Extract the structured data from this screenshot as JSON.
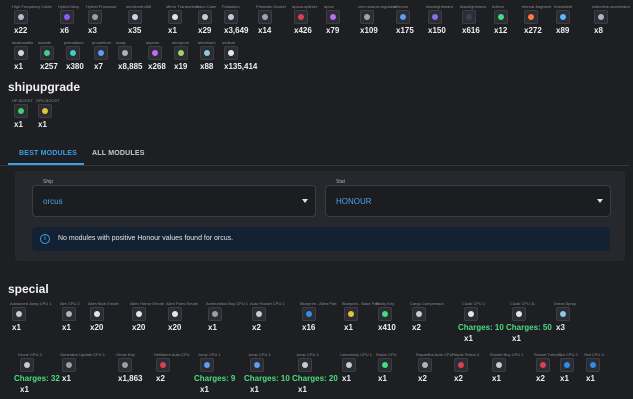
{
  "misc_row1": [
    {
      "label": "High Frequency Cable",
      "count": "x22",
      "color": "#b8bcc4"
    },
    {
      "label": "Hybrid Alloy",
      "count": "x6",
      "color": "#8b5cf6"
    },
    {
      "label": "Hybrid Processor",
      "count": "x3",
      "color": "#9aa0aa"
    },
    {
      "label": "mindcontrol56",
      "count": "x35",
      "color": "#cfd3da"
    },
    {
      "label": "Mirror Transceiver",
      "count": "x1",
      "color": "#dfe2e8"
    },
    {
      "label": "Nano Case",
      "count": "x29",
      "color": "#c9ccd2"
    },
    {
      "label": "Palladium",
      "count": "x3,649",
      "color": "#c4c8cf"
    },
    {
      "label": "Prismatic Socket",
      "count": "x14",
      "color": "#a0a4ab"
    },
    {
      "label": "apoca-splinter",
      "count": "x426",
      "color": "#d9434f"
    },
    {
      "label": "aprox",
      "count": "x79",
      "color": "#b66df2"
    },
    {
      "label": "cmrr-swarm-regulator",
      "count": "x109",
      "color": "#9ea3ac"
    },
    {
      "label": "bifercon",
      "count": "x175",
      "color": "#5b9ff0"
    },
    {
      "label": "blacklightneant",
      "count": "x150",
      "color": "#8c6be8"
    },
    {
      "label": "blacklightmecs",
      "count": "x616",
      "color": "#3a3f55"
    },
    {
      "label": "boltron",
      "count": "x12",
      "color": "#3fe07a"
    },
    {
      "label": "eternal-fragment",
      "count": "x272",
      "color": "#ff7a3d"
    },
    {
      "label": "frostshield",
      "count": "x89",
      "color": "#5ab6ff"
    },
    {
      "label": "indicotine-accelerator",
      "count": "x8",
      "color": "#b0b4bc"
    }
  ],
  "misc_row2": [
    {
      "label": "lavaboxable",
      "count": "x1",
      "color": "#d7dbe1"
    },
    {
      "label": "lunarite",
      "count": "x257",
      "color": "#3fd18a"
    },
    {
      "label": "prismatium",
      "count": "x380",
      "color": "#3fd1c2"
    },
    {
      "label": "prometium",
      "count": "x7",
      "color": "#5b9ff0"
    },
    {
      "label": "scrap",
      "count": "x8,885",
      "color": "#aeb3bb"
    },
    {
      "label": "seprom",
      "count": "x268",
      "color": "#c06af2"
    },
    {
      "label": "seroprom",
      "count": "x19",
      "color": "#9ad86a"
    },
    {
      "label": "tetrelnium",
      "count": "x88",
      "color": "#8ec7e0"
    },
    {
      "label": "uridium",
      "count": "x135,414",
      "color": "#e6ecf5"
    }
  ],
  "shipupgrade": {
    "title": "shipupgrade",
    "items": [
      {
        "label": "HP-BOOST",
        "count": "x1",
        "color": "#3fd16a"
      },
      {
        "label": "SPD-BOOST",
        "count": "x1",
        "color": "#e0c53a"
      }
    ]
  },
  "tabs": {
    "best": "BEST MODULES",
    "all": "ALL MODULES"
  },
  "ship_select": {
    "label": "Ship",
    "value": "orcus"
  },
  "stat_select": {
    "label": "Stat",
    "value": "HONOUR"
  },
  "info_message": "No modules with positive Honour values found for orcus.",
  "special": {
    "title": "special",
    "row1": [
      {
        "label": "Advanced Jump CPU 1",
        "count": "x1",
        "charges": "",
        "color": "#c9ccd2"
      },
      {
        "label": "Aim CPU 2",
        "count": "x1",
        "charges": "",
        "color": "#b0b4bc"
      },
      {
        "label": "Alien Blob Emote",
        "count": "x20",
        "charges": "",
        "color": "#e4e7ec"
      },
      {
        "label": "Alien Horror Emote",
        "count": "x20",
        "charges": "",
        "color": "#e4e7ec"
      },
      {
        "label": "Alien Parts Emote",
        "count": "x20",
        "charges": "",
        "color": "#e4e7ec"
      },
      {
        "label": "Ammunition Buy CPU 1",
        "count": "x1",
        "charges": "",
        "color": "#9aa0aa"
      },
      {
        "label": "Auto Rocket CPU 1",
        "count": "x2",
        "charges": "",
        "color": "#c9ccd2"
      },
      {
        "label": "Blueprint - Alien Part",
        "count": "x16",
        "charges": "",
        "color": "#2c8ef0"
      },
      {
        "label": "Blueprint - Base Part",
        "count": "x1",
        "charges": "",
        "color": "#e0c53a"
      },
      {
        "label": "Booty Key",
        "count": "x410",
        "charges": "",
        "color": "#3fe07a"
      },
      {
        "label": "Cargo Compressor",
        "count": "x2",
        "charges": "",
        "color": "#c9ccd2"
      },
      {
        "label": "Cloak CPU 1",
        "count": "x1",
        "charges": "Charges: 10",
        "color": "#e4e7ec"
      },
      {
        "label": "Cloak CPU 2L",
        "count": "x1",
        "charges": "Charges: 50",
        "color": "#e4e7ec"
      },
      {
        "label": "Dmos Spray",
        "count": "x3",
        "charges": "",
        "color": "#8ec7e0"
      }
    ],
    "row2": [
      {
        "label": "Drone CPU 2",
        "count": "x1",
        "charges": "Charges: 32",
        "color": "#c9ccd2"
      },
      {
        "label": "Generator Update CPU 1",
        "count": "x1",
        "charges": "",
        "color": "#9aa0aa"
      },
      {
        "label": "Ghost Key",
        "count": "x1,863",
        "charges": "",
        "color": "#9aa0aa"
      },
      {
        "label": "Hellstorm Auto CPU",
        "count": "x2",
        "charges": "",
        "color": "#d9434f"
      },
      {
        "label": "Jump CPU 1",
        "count": "x1",
        "charges": "Charges: 9",
        "color": "#5b9ff0"
      },
      {
        "label": "Jump CPU 1",
        "count": "x1",
        "charges": "Charges: 10",
        "color": "#5b9ff0"
      },
      {
        "label": "Jump CPU 2",
        "count": "x1",
        "charges": "Charges: 20",
        "color": "#c9ccd2"
      },
      {
        "label": "Laboratory CPU 1",
        "count": "x1",
        "charges": "",
        "color": "#c9ccd2"
      },
      {
        "label": "Radar CPU",
        "count": "x1",
        "charges": "",
        "color": "#3fe07a"
      },
      {
        "label": "RepairBot Auto CPU",
        "count": "x2",
        "charges": "",
        "color": "#b0b4bc"
      },
      {
        "label": "Repair Robot 4",
        "count": "x2",
        "charges": "",
        "color": "#d9434f"
      },
      {
        "label": "Rocket Buy CPU 1",
        "count": "x1",
        "charges": "",
        "color": "#c9ccd2"
      },
      {
        "label": "Rocket Turbo 1",
        "count": "x2",
        "charges": "",
        "color": "#d9434f"
      },
      {
        "label": "Slot CPU 2",
        "count": "x1",
        "charges": "",
        "color": "#2c8ef0"
      },
      {
        "label": "Slot CPU 4",
        "count": "x1",
        "charges": "",
        "color": "#2c8ef0"
      }
    ]
  }
}
